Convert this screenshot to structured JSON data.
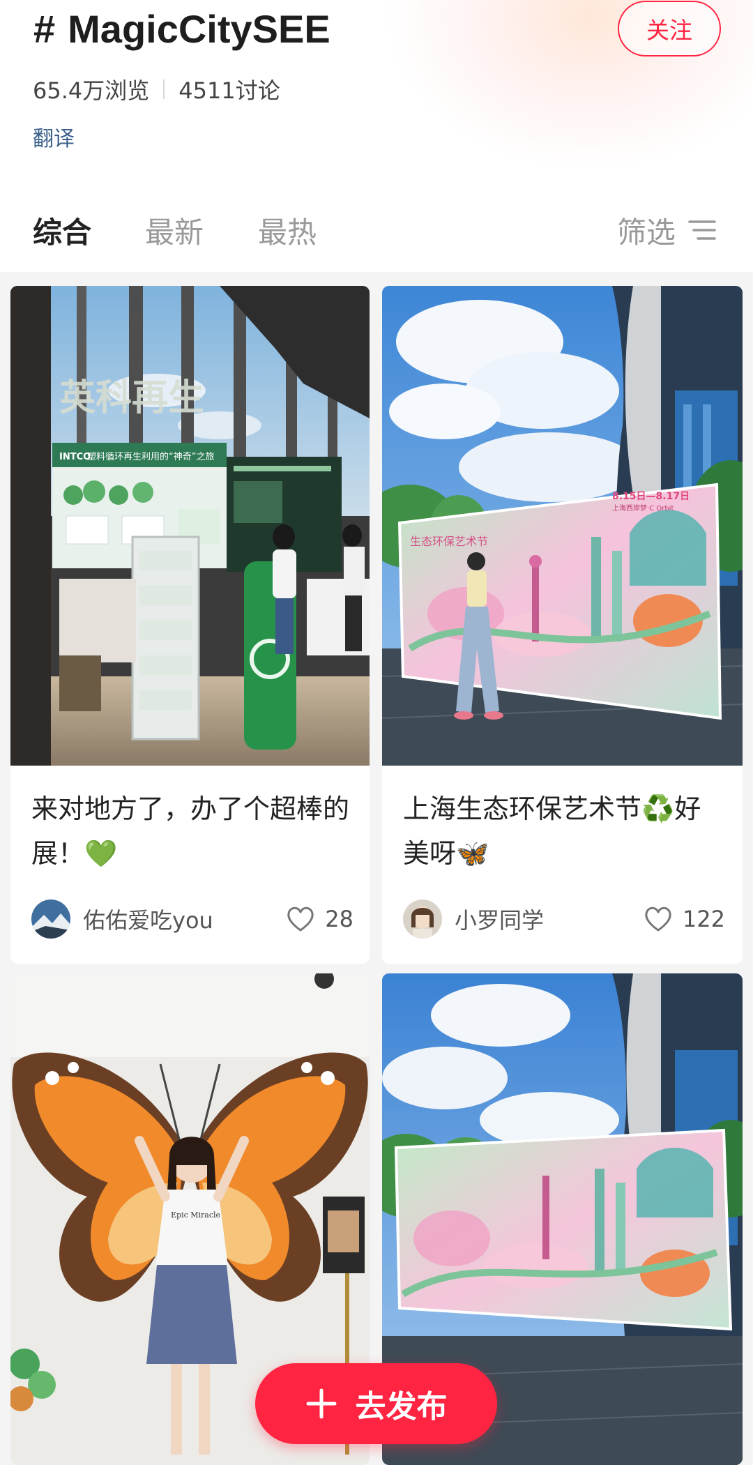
{
  "header": {
    "hash_symbol": "#",
    "topic_name": "MagicCitySEE",
    "follow_label": "关注",
    "views": "65.4万浏览",
    "discussions": "4511讨论",
    "translate_label": "翻译"
  },
  "tabs": [
    {
      "label": "综合",
      "active": true
    },
    {
      "label": "最新",
      "active": false
    },
    {
      "label": "最热",
      "active": false
    }
  ],
  "filter": {
    "label": "筛选",
    "icon": "filter-lines-icon"
  },
  "posts": [
    {
      "title": "来对地方了，办了个超棒的展！💚",
      "author": "佑佑爱吃you",
      "likes": "28"
    },
    {
      "title": "上海生态环保艺术节♻️好美呀🦋",
      "author": "小罗同学",
      "likes": "122"
    },
    {
      "title": "",
      "author": "",
      "likes": ""
    },
    {
      "title": "",
      "author": "",
      "likes": ""
    }
  ],
  "image_text": {
    "booth_sign": "英科再生",
    "booth_brand": "INTCO",
    "booth_banner": "塑料循环再生利用的“神奇”之旅",
    "board_date": "8.15日—8.17日",
    "board_venue": "上海西岸梦·C Orbit",
    "board_title": "生态环保艺术节",
    "shirt_text": "Epic Miracle"
  },
  "publish_button": {
    "label": "去发布"
  },
  "colors": {
    "accent": "#ff2442",
    "link": "#3a5f8a"
  }
}
